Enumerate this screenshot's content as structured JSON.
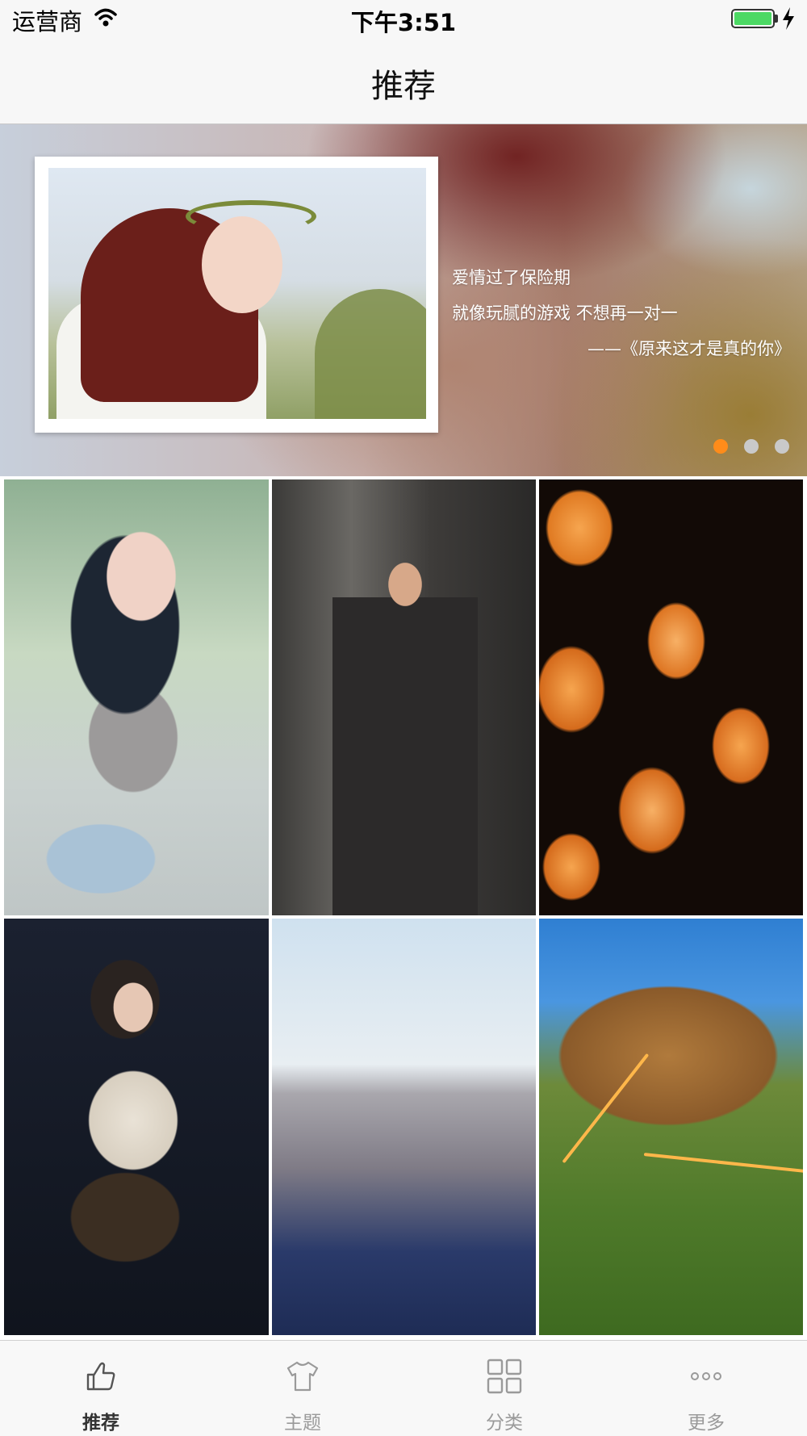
{
  "status_bar": {
    "carrier": "运营商",
    "time": "下午3:51",
    "battery_color": "#4cd964"
  },
  "navbar": {
    "title": "推荐"
  },
  "banner": {
    "lines": [
      "爱情过了保险期",
      "就像玩腻的游戏  不想再一对一"
    ],
    "credit": "——《原来这才是真的你》",
    "page_count": 3,
    "current_page": 1,
    "dot_active_color": "#ff8c1a",
    "dot_inactive_color": "#c9c9c9"
  },
  "grid": {
    "tiles": [
      {
        "name": "girl-with-bicycle-photo"
      },
      {
        "name": "man-in-suit-photo"
      },
      {
        "name": "paper-lanterns-photo"
      },
      {
        "name": "game-character-photo"
      },
      {
        "name": "city-bridge-photo"
      },
      {
        "name": "mountain-road-photo"
      }
    ]
  },
  "tabbar": {
    "tabs": [
      {
        "label": "推荐",
        "icon": "thumbs-up-icon",
        "active": true
      },
      {
        "label": "主题",
        "icon": "tshirt-icon",
        "active": false
      },
      {
        "label": "分类",
        "icon": "grid-icon",
        "active": false
      },
      {
        "label": "更多",
        "icon": "more-dots-icon",
        "active": false
      }
    ],
    "active_color": "#333333",
    "inactive_color": "#9a9a9a"
  }
}
